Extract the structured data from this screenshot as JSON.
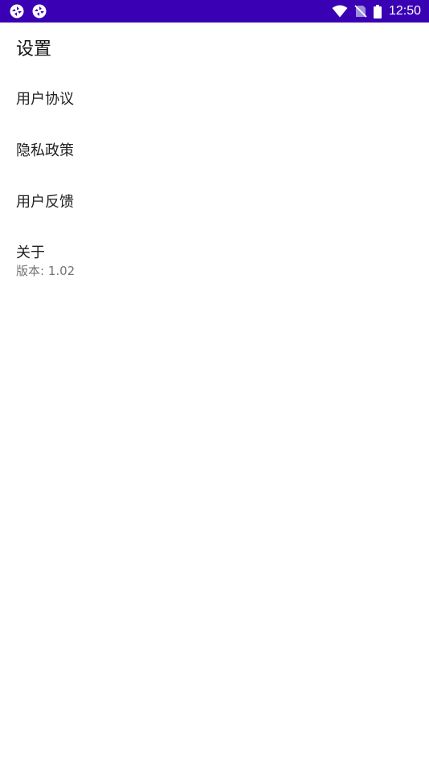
{
  "status_bar": {
    "time": "12:50",
    "left_icons": [
      "app-notification-icon",
      "app-notification-icon"
    ],
    "right_icons": [
      "wifi-icon",
      "no-sim-icon",
      "battery-icon"
    ],
    "background_color": "#3a00b4"
  },
  "page": {
    "title": "设置"
  },
  "settings": {
    "items": [
      {
        "title": "用户协议"
      },
      {
        "title": "隐私政策"
      },
      {
        "title": "用户反馈"
      },
      {
        "title": "关于",
        "summary": "版本: 1.02"
      }
    ]
  }
}
